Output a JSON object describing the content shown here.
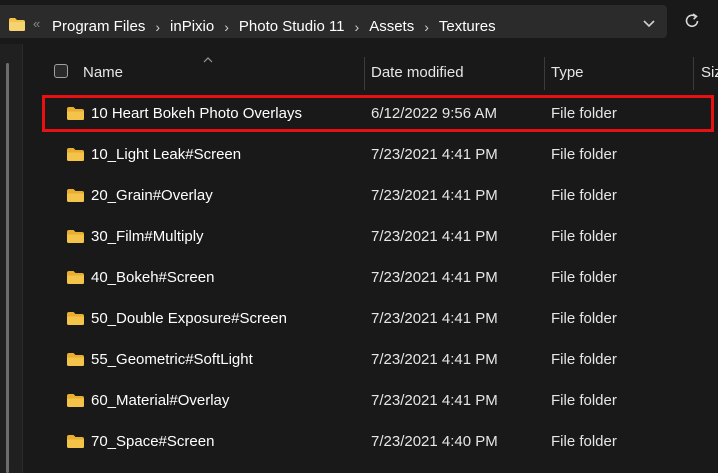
{
  "address_bar": {
    "overflow_glyph": "«",
    "breadcrumbs": [
      "Program Files",
      "inPixio",
      "Photo Studio 11",
      "Assets",
      "Textures"
    ]
  },
  "columns": {
    "name": "Name",
    "date_modified": "Date modified",
    "type": "Type",
    "size_partial": "Siz"
  },
  "rows": [
    {
      "name": "10 Heart Bokeh Photo Overlays",
      "date": "6/12/2022 9:56 AM",
      "type": "File folder",
      "highlighted": true
    },
    {
      "name": "10_Light Leak#Screen",
      "date": "7/23/2021 4:41 PM",
      "type": "File folder"
    },
    {
      "name": "20_Grain#Overlay",
      "date": "7/23/2021 4:41 PM",
      "type": "File folder"
    },
    {
      "name": "30_Film#Multiply",
      "date": "7/23/2021 4:41 PM",
      "type": "File folder"
    },
    {
      "name": "40_Bokeh#Screen",
      "date": "7/23/2021 4:41 PM",
      "type": "File folder"
    },
    {
      "name": "50_Double Exposure#Screen",
      "date": "7/23/2021 4:41 PM",
      "type": "File folder"
    },
    {
      "name": "55_Geometric#SoftLight",
      "date": "7/23/2021 4:41 PM",
      "type": "File folder"
    },
    {
      "name": "60_Material#Overlay",
      "date": "7/23/2021 4:41 PM",
      "type": "File folder"
    },
    {
      "name": "70_Space#Screen",
      "date": "7/23/2021 4:40 PM",
      "type": "File folder"
    }
  ],
  "colors": {
    "background": "#191919",
    "folder_yellow": "#f3c34a",
    "highlight_border": "#e81010"
  },
  "icons": [
    "folder-icon",
    "chevron-down-icon",
    "refresh-icon",
    "sort-ascending-icon"
  ]
}
